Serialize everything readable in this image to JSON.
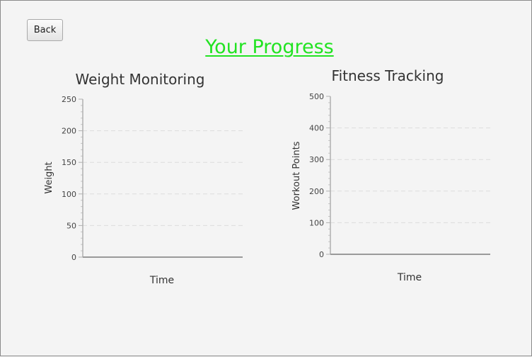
{
  "back_label": "Back",
  "page_title": "Your Progress",
  "title_color": "#22e322",
  "chart_data": [
    {
      "type": "line",
      "title": "Weight Monitoring",
      "xlabel": "Time",
      "ylabel": "Weight",
      "ylim": [
        0,
        250
      ],
      "yticks": [
        "0",
        "50",
        "100",
        "150",
        "200",
        "250"
      ],
      "series": [],
      "grid": true
    },
    {
      "type": "line",
      "title": "Fitness Tracking",
      "xlabel": "Time",
      "ylabel": "Workout Points",
      "ylim": [
        0,
        500
      ],
      "yticks": [
        "0",
        "100",
        "200",
        "300",
        "400",
        "500"
      ],
      "series": [],
      "grid": true
    }
  ]
}
